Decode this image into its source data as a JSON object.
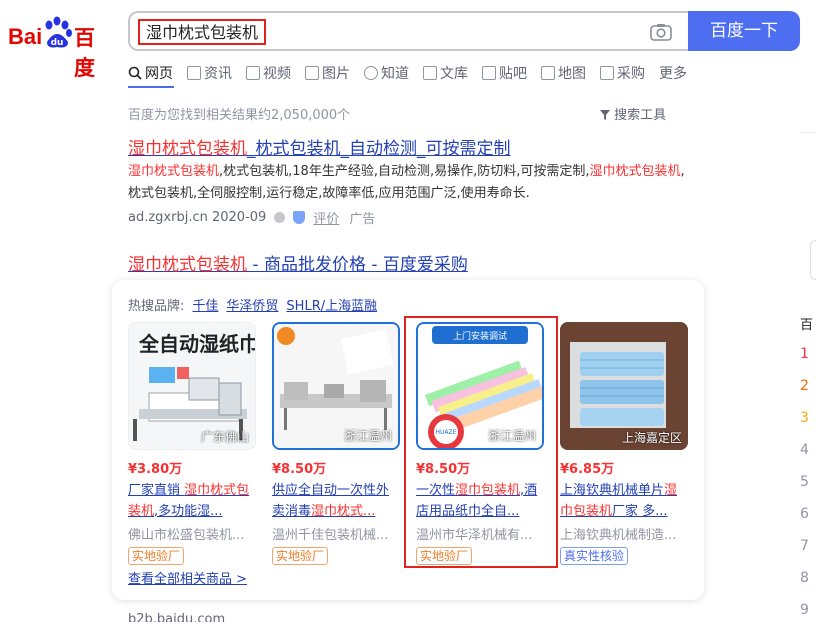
{
  "header": {
    "logo_text": "Bai",
    "logo_cn": "百度",
    "search_value": "湿巾枕式包装机",
    "search_button": "百度一下"
  },
  "tabs": [
    {
      "label": "网页",
      "active": true,
      "icon": "search-icon"
    },
    {
      "label": "资讯",
      "icon": "news-icon"
    },
    {
      "label": "视频",
      "icon": "video-icon"
    },
    {
      "label": "图片",
      "icon": "image-icon"
    },
    {
      "label": "知道",
      "icon": "question-icon"
    },
    {
      "label": "文库",
      "icon": "document-icon"
    },
    {
      "label": "贴吧",
      "icon": "tieba-icon"
    },
    {
      "label": "地图",
      "icon": "map-icon"
    },
    {
      "label": "采购",
      "icon": "shop-icon"
    },
    {
      "label": "更多"
    }
  ],
  "result_count": "百度为您找到相关结果约2,050,000个",
  "search_tools": "搜索工具",
  "result1": {
    "title_hl": "湿巾枕式包装机",
    "title_rest": "_枕式包装机_自动检测_可按需定制",
    "desc_hl1": "湿巾枕式包装机",
    "desc_mid": ",枕式包装机,18年生产经验,自动检测,易操作,防切料,可按需定制,",
    "desc_hl2": "湿巾枕式包装机",
    "desc_end": ",枕式包装机,全伺服控制,运行稳定,故障率低,应用范围广泛,使用寿命长.",
    "domain": "ad.zgxrbj.cn 2020-09",
    "eval": "评价",
    "ad": "广告"
  },
  "result2": {
    "title_hl": "湿巾枕式包装机",
    "title_rest": " - 商品批发价格 - 百度爱采购"
  },
  "brands": {
    "label": "热搜品牌:",
    "items": [
      "千佳",
      "华泽侨贸",
      "SHLR/上海蓝融"
    ]
  },
  "products": [
    {
      "location": "广东佛山",
      "price": "¥3.80万",
      "name_pre": "厂家直销 ",
      "name_hl": "湿巾枕式包装机",
      "name_post": ",多功能湿...",
      "company": "佛山市松盛包装机...",
      "badge": "实地验厂",
      "img_title": "全自动湿纸巾包装机",
      "img_brand": "松盛"
    },
    {
      "location": "浙江温州",
      "price": "¥8.50万",
      "name_pre": "供应全自动一次性外卖消毒",
      "name_hl": "湿巾枕式...",
      "name_post": "",
      "company": "温州千佳包装机械...",
      "badge": "实地验厂"
    },
    {
      "location": "浙江温州",
      "price": "¥8.50万",
      "name_pre": "一次性",
      "name_hl": "湿巾包装机",
      "name_post": ",酒店用品纸巾全自...",
      "company": "温州市华泽机械有...",
      "badge": "实地验厂",
      "img_banner": "上门安装调试",
      "img_brand": "HUAZE"
    },
    {
      "location": "上海嘉定区",
      "price": "¥6.85万",
      "name_pre": "上海钦典机械单片",
      "name_hl": "湿巾包装机",
      "name_post": "厂家 多...",
      "company": "上海钦典机械制造...",
      "badge": "真实性核验"
    }
  ],
  "all_products_link": "查看全部相关商品 >",
  "source": "b2b.baidu.com",
  "right": {
    "rank_head": "百",
    "ranks": [
      "1",
      "2",
      "3",
      "4",
      "5",
      "6",
      "7",
      "8",
      "9"
    ]
  }
}
